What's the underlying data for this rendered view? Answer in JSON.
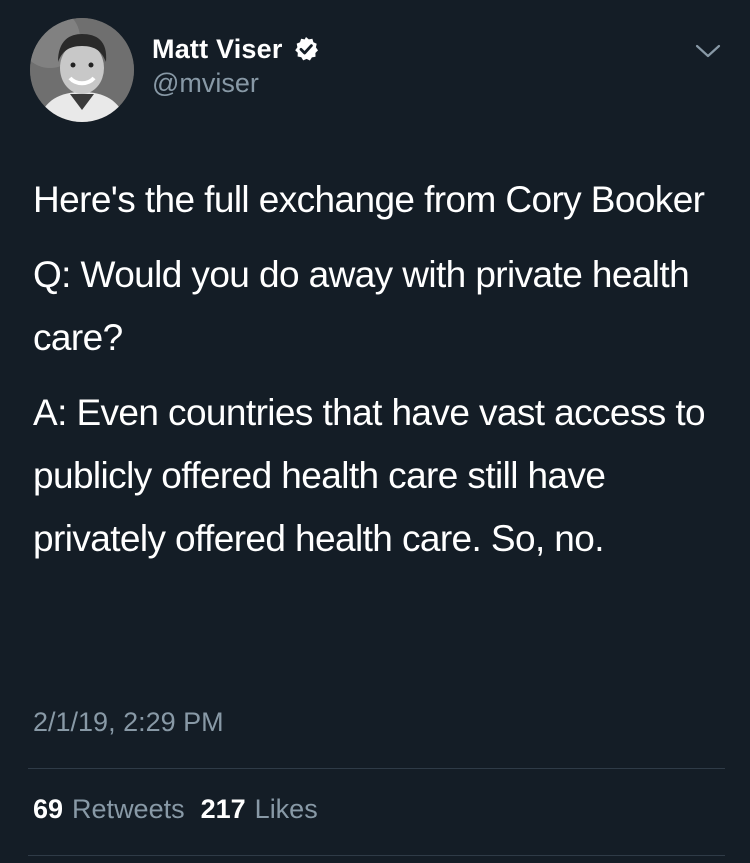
{
  "author": {
    "display_name": "Matt Viser",
    "handle": "@mviser",
    "verified_icon": "verified-badge-icon",
    "avatar_icon": "profile-photo"
  },
  "menu_icon": "chevron-down-icon",
  "tweet": {
    "paragraphs": [
      "Here's the full exchange from Cory Booker",
      "Q: Would you do away with private health care?",
      "A: Even countries that have vast access to publicly offered health care still have privately offered health care. So, no."
    ],
    "timestamp": "2/1/19, 2:29 PM"
  },
  "stats": {
    "retweets_count": "69",
    "retweets_label": "Retweets",
    "likes_count": "217",
    "likes_label": "Likes"
  },
  "colors": {
    "background": "#141d26",
    "text_primary": "#ffffff",
    "text_secondary": "#8899a6",
    "divider": "#2f3b47"
  }
}
